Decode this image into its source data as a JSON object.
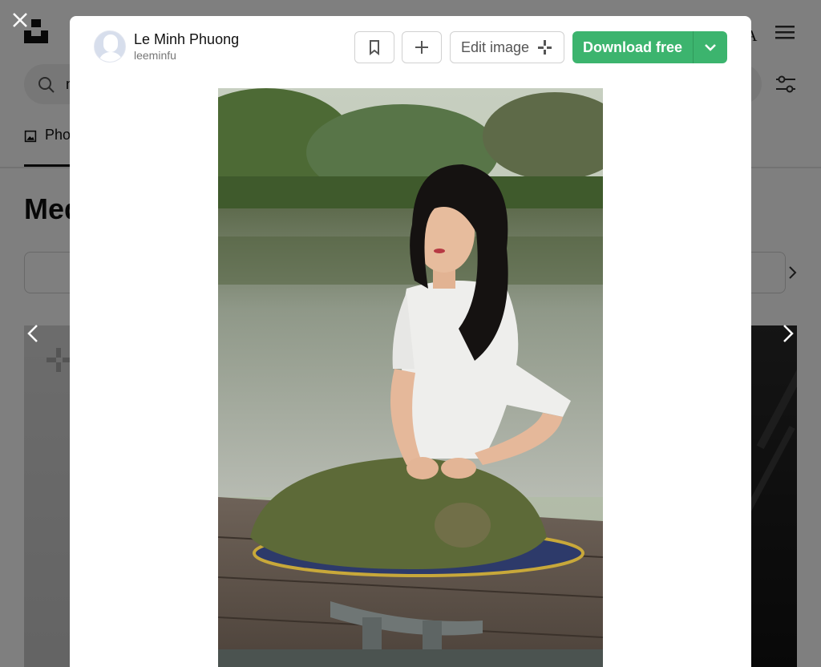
{
  "background": {
    "search_text": "m",
    "tab_label": "Pho",
    "heading": "Med",
    "header_letter": "A"
  },
  "modal": {
    "author": {
      "name": "Le Minh Phuong",
      "username": "leeminfu"
    },
    "actions": {
      "edit_label": "Edit image",
      "download_label": "Download free"
    },
    "photo": {
      "alt": "Woman meditating on a wooden dock by the water"
    }
  },
  "icons": {
    "close": "close-icon",
    "prev": "chevron-left-icon",
    "next": "chevron-right-icon",
    "bookmark": "bookmark-icon",
    "add": "plus-icon",
    "edit": "edit-sparkle-icon",
    "download_more": "chevron-down-icon"
  },
  "colors": {
    "download_green": "#3cb46e",
    "overlay": "rgba(0,0,0,0.5)"
  }
}
